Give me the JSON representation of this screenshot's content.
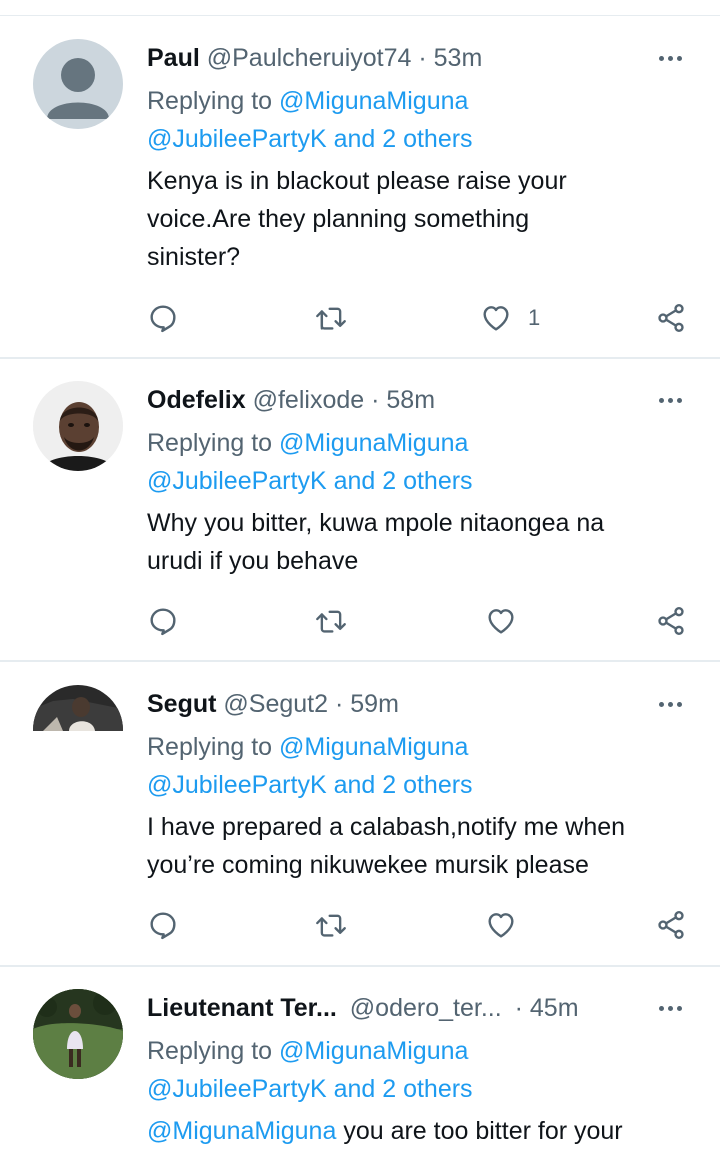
{
  "tweets": [
    {
      "name": "Paul",
      "handle": "@Paulcheruiyot74",
      "dot": "·",
      "time": "53m",
      "replying_prefix": "Replying to",
      "replying_user": "@MigunaMiguna",
      "replying_others": "@JubileePartyK and 2 others",
      "text_lines": [
        "Kenya is in blackout please raise your",
        "voice.Are they planning something",
        "sinister?"
      ],
      "like_count": "1"
    },
    {
      "name": "Odefelix",
      "handle": "@felixode",
      "dot": "·",
      "time": "58m",
      "replying_prefix": "Replying to",
      "replying_user": "@MigunaMiguna",
      "replying_others": "@JubileePartyK and 2 others",
      "text_lines": [
        "Why you bitter, kuwa mpole nitaongea na",
        "urudi if you behave"
      ]
    },
    {
      "name": "Segut",
      "handle": "@Segut2",
      "dot": "·",
      "time": "59m",
      "replying_prefix": "Replying to",
      "replying_user": "@MigunaMiguna",
      "replying_others": "@JubileePartyK and 2 others",
      "text_lines": [
        "I have prepared a calabash,notify me when",
        "you’re coming nikuwekee mursik please"
      ]
    },
    {
      "name": "Lieutenant Ter...",
      "handle": "@odero_ter...",
      "dot": "·",
      "time": "45m",
      "replying_prefix": "Replying to",
      "replying_user": "@MigunaMiguna",
      "replying_others": "@JubileePartyK and 2 others",
      "text_mention": "@MigunaMiguna",
      "text_rest": " you are too bitter for your"
    }
  ],
  "icons": {
    "reply": "reply-icon",
    "retweet": "retweet-icon",
    "like": "heart-icon",
    "share": "share-icon",
    "more": "more-icon"
  },
  "colors": {
    "link": "#1d9bf0",
    "secondary_text": "#536471",
    "divider": "#e6ecf0"
  }
}
